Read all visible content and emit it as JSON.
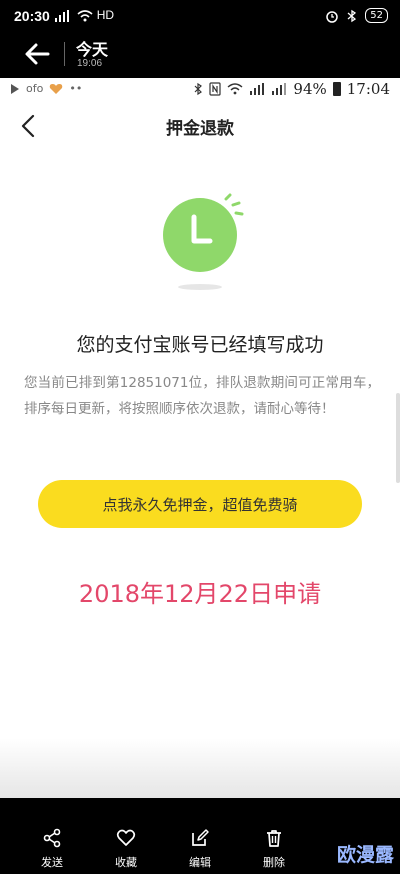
{
  "outer_status": {
    "time": "20:30",
    "network": "HD",
    "battery": "52"
  },
  "viewer": {
    "title": "今天",
    "subtitle": "19:06"
  },
  "inner_status": {
    "app_label": "ofo",
    "battery_pct": "94%",
    "time": "17:04"
  },
  "app": {
    "title": "押金退款",
    "headline": "您的支付宝账号已经填写成功",
    "description": "您当前已排到第12851071位，排队退款期间可正常用车，排序每日更新，将按照顺序依次退款，请耐心等待！",
    "cta_label": "点我永久免押金，超值免费骑",
    "date_text": "2018年12月22日申请",
    "accent_yellow": "#FADC1F",
    "date_color": "#E3476A",
    "clock_green": "#8FD86A"
  },
  "toolbar": {
    "items": [
      {
        "label": "发送",
        "icon": "share-icon"
      },
      {
        "label": "收藏",
        "icon": "heart-icon"
      },
      {
        "label": "编辑",
        "icon": "edit-icon"
      },
      {
        "label": "删除",
        "icon": "trash-icon"
      }
    ]
  },
  "watermark": "欧漫露"
}
